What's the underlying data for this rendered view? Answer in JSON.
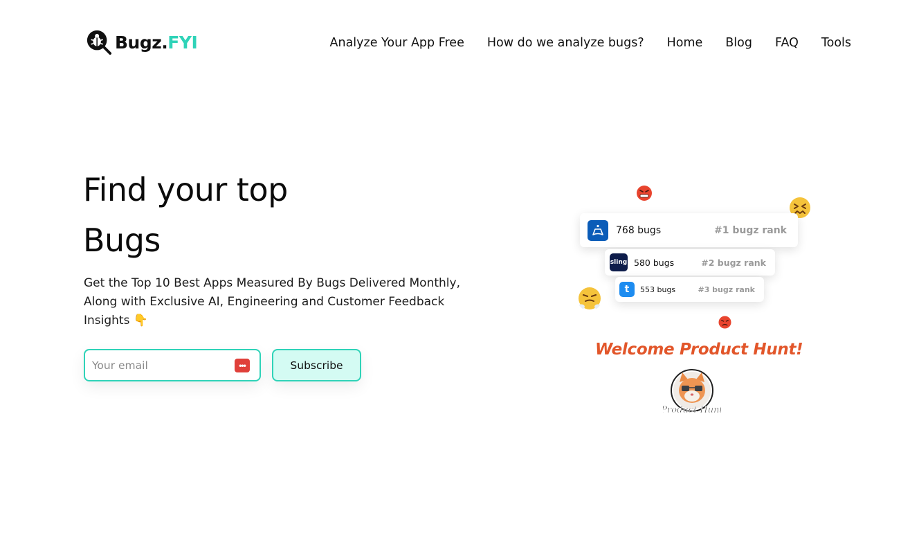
{
  "brand": {
    "name_main": "Bugz.",
    "name_accent": "FYI"
  },
  "nav": [
    {
      "label": "Analyze Your App Free"
    },
    {
      "label": "How do we analyze bugs?"
    },
    {
      "label": "Home"
    },
    {
      "label": "Blog"
    },
    {
      "label": "FAQ"
    },
    {
      "label": "Tools"
    }
  ],
  "hero": {
    "title_line1": "Find your top",
    "title_line2": "Bugs",
    "subtitle": "Get the Top 10 Best Apps Measured By Bugs Delivered Monthly, Along with Exclusive AI, Engineering and Customer Feedback Insights 👇"
  },
  "subscribe": {
    "email_placeholder": "Your email",
    "email_value": "",
    "button_label": "Subscribe"
  },
  "ranking": [
    {
      "app_icon": "gamepad-app-icon",
      "icon_text": "🎮",
      "bugs": "768 bugs",
      "rank": "#1 bugz rank"
    },
    {
      "app_icon": "sling-app-icon",
      "icon_text": "sling",
      "bugs": "580 bugs",
      "rank": "#2 bugz rank"
    },
    {
      "app_icon": "tubi-app-icon",
      "icon_text": "t",
      "bugs": "553 bugs",
      "rank": "#3 bugz rank"
    }
  ],
  "colors": {
    "accent": "#2fd3b8",
    "button_bg": "#d4fbf3",
    "welcome": "#e2562a",
    "emoji_angry": "#e8442e",
    "emoji_yellow": "#f5c33b"
  },
  "welcome": {
    "text": "Welcome Product Hunt!",
    "badge_label": "Product Hunt"
  }
}
